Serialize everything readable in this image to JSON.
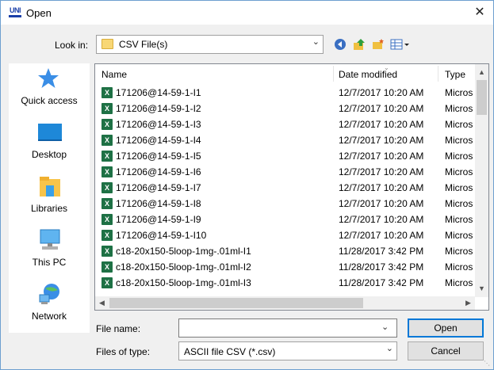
{
  "window": {
    "title": "Open",
    "app_icon_text": "UNI",
    "close_glyph": "✕"
  },
  "lookin": {
    "label": "Look in:",
    "value": "CSV File(s)"
  },
  "places": [
    {
      "label": "Quick access",
      "icon": "star-icon"
    },
    {
      "label": "Desktop",
      "icon": "desktop-icon"
    },
    {
      "label": "Libraries",
      "icon": "libraries-icon"
    },
    {
      "label": "This PC",
      "icon": "computer-icon"
    },
    {
      "label": "Network",
      "icon": "network-icon"
    }
  ],
  "columns": {
    "name": "Name",
    "date": "Date modified",
    "type": "Type"
  },
  "files": [
    {
      "name": "171206@14-59-1-I1",
      "date": "12/7/2017 10:20 AM",
      "type": "Micros"
    },
    {
      "name": "171206@14-59-1-I2",
      "date": "12/7/2017 10:20 AM",
      "type": "Micros"
    },
    {
      "name": "171206@14-59-1-I3",
      "date": "12/7/2017 10:20 AM",
      "type": "Micros"
    },
    {
      "name": "171206@14-59-1-I4",
      "date": "12/7/2017 10:20 AM",
      "type": "Micros"
    },
    {
      "name": "171206@14-59-1-I5",
      "date": "12/7/2017 10:20 AM",
      "type": "Micros"
    },
    {
      "name": "171206@14-59-1-I6",
      "date": "12/7/2017 10:20 AM",
      "type": "Micros"
    },
    {
      "name": "171206@14-59-1-I7",
      "date": "12/7/2017 10:20 AM",
      "type": "Micros"
    },
    {
      "name": "171206@14-59-1-I8",
      "date": "12/7/2017 10:20 AM",
      "type": "Micros"
    },
    {
      "name": "171206@14-59-1-I9",
      "date": "12/7/2017 10:20 AM",
      "type": "Micros"
    },
    {
      "name": "171206@14-59-1-I10",
      "date": "12/7/2017 10:20 AM",
      "type": "Micros"
    },
    {
      "name": "c18-20x150-5loop-1mg-.01ml-I1",
      "date": "11/28/2017 3:42 PM",
      "type": "Micros"
    },
    {
      "name": "c18-20x150-5loop-1mg-.01ml-I2",
      "date": "11/28/2017 3:42 PM",
      "type": "Micros"
    },
    {
      "name": "c18-20x150-5loop-1mg-.01ml-I3",
      "date": "11/28/2017 3:42 PM",
      "type": "Micros"
    }
  ],
  "file_icon_glyph": "X",
  "filename": {
    "label": "File name:",
    "value": ""
  },
  "filetype": {
    "label": "Files of type:",
    "value": "ASCII file CSV (*.csv)"
  },
  "buttons": {
    "open": "Open",
    "cancel": "Cancel"
  },
  "colors": {
    "accent": "#0078d7",
    "excel_green": "#1e7145",
    "folder_yellow": "#f8d775"
  }
}
